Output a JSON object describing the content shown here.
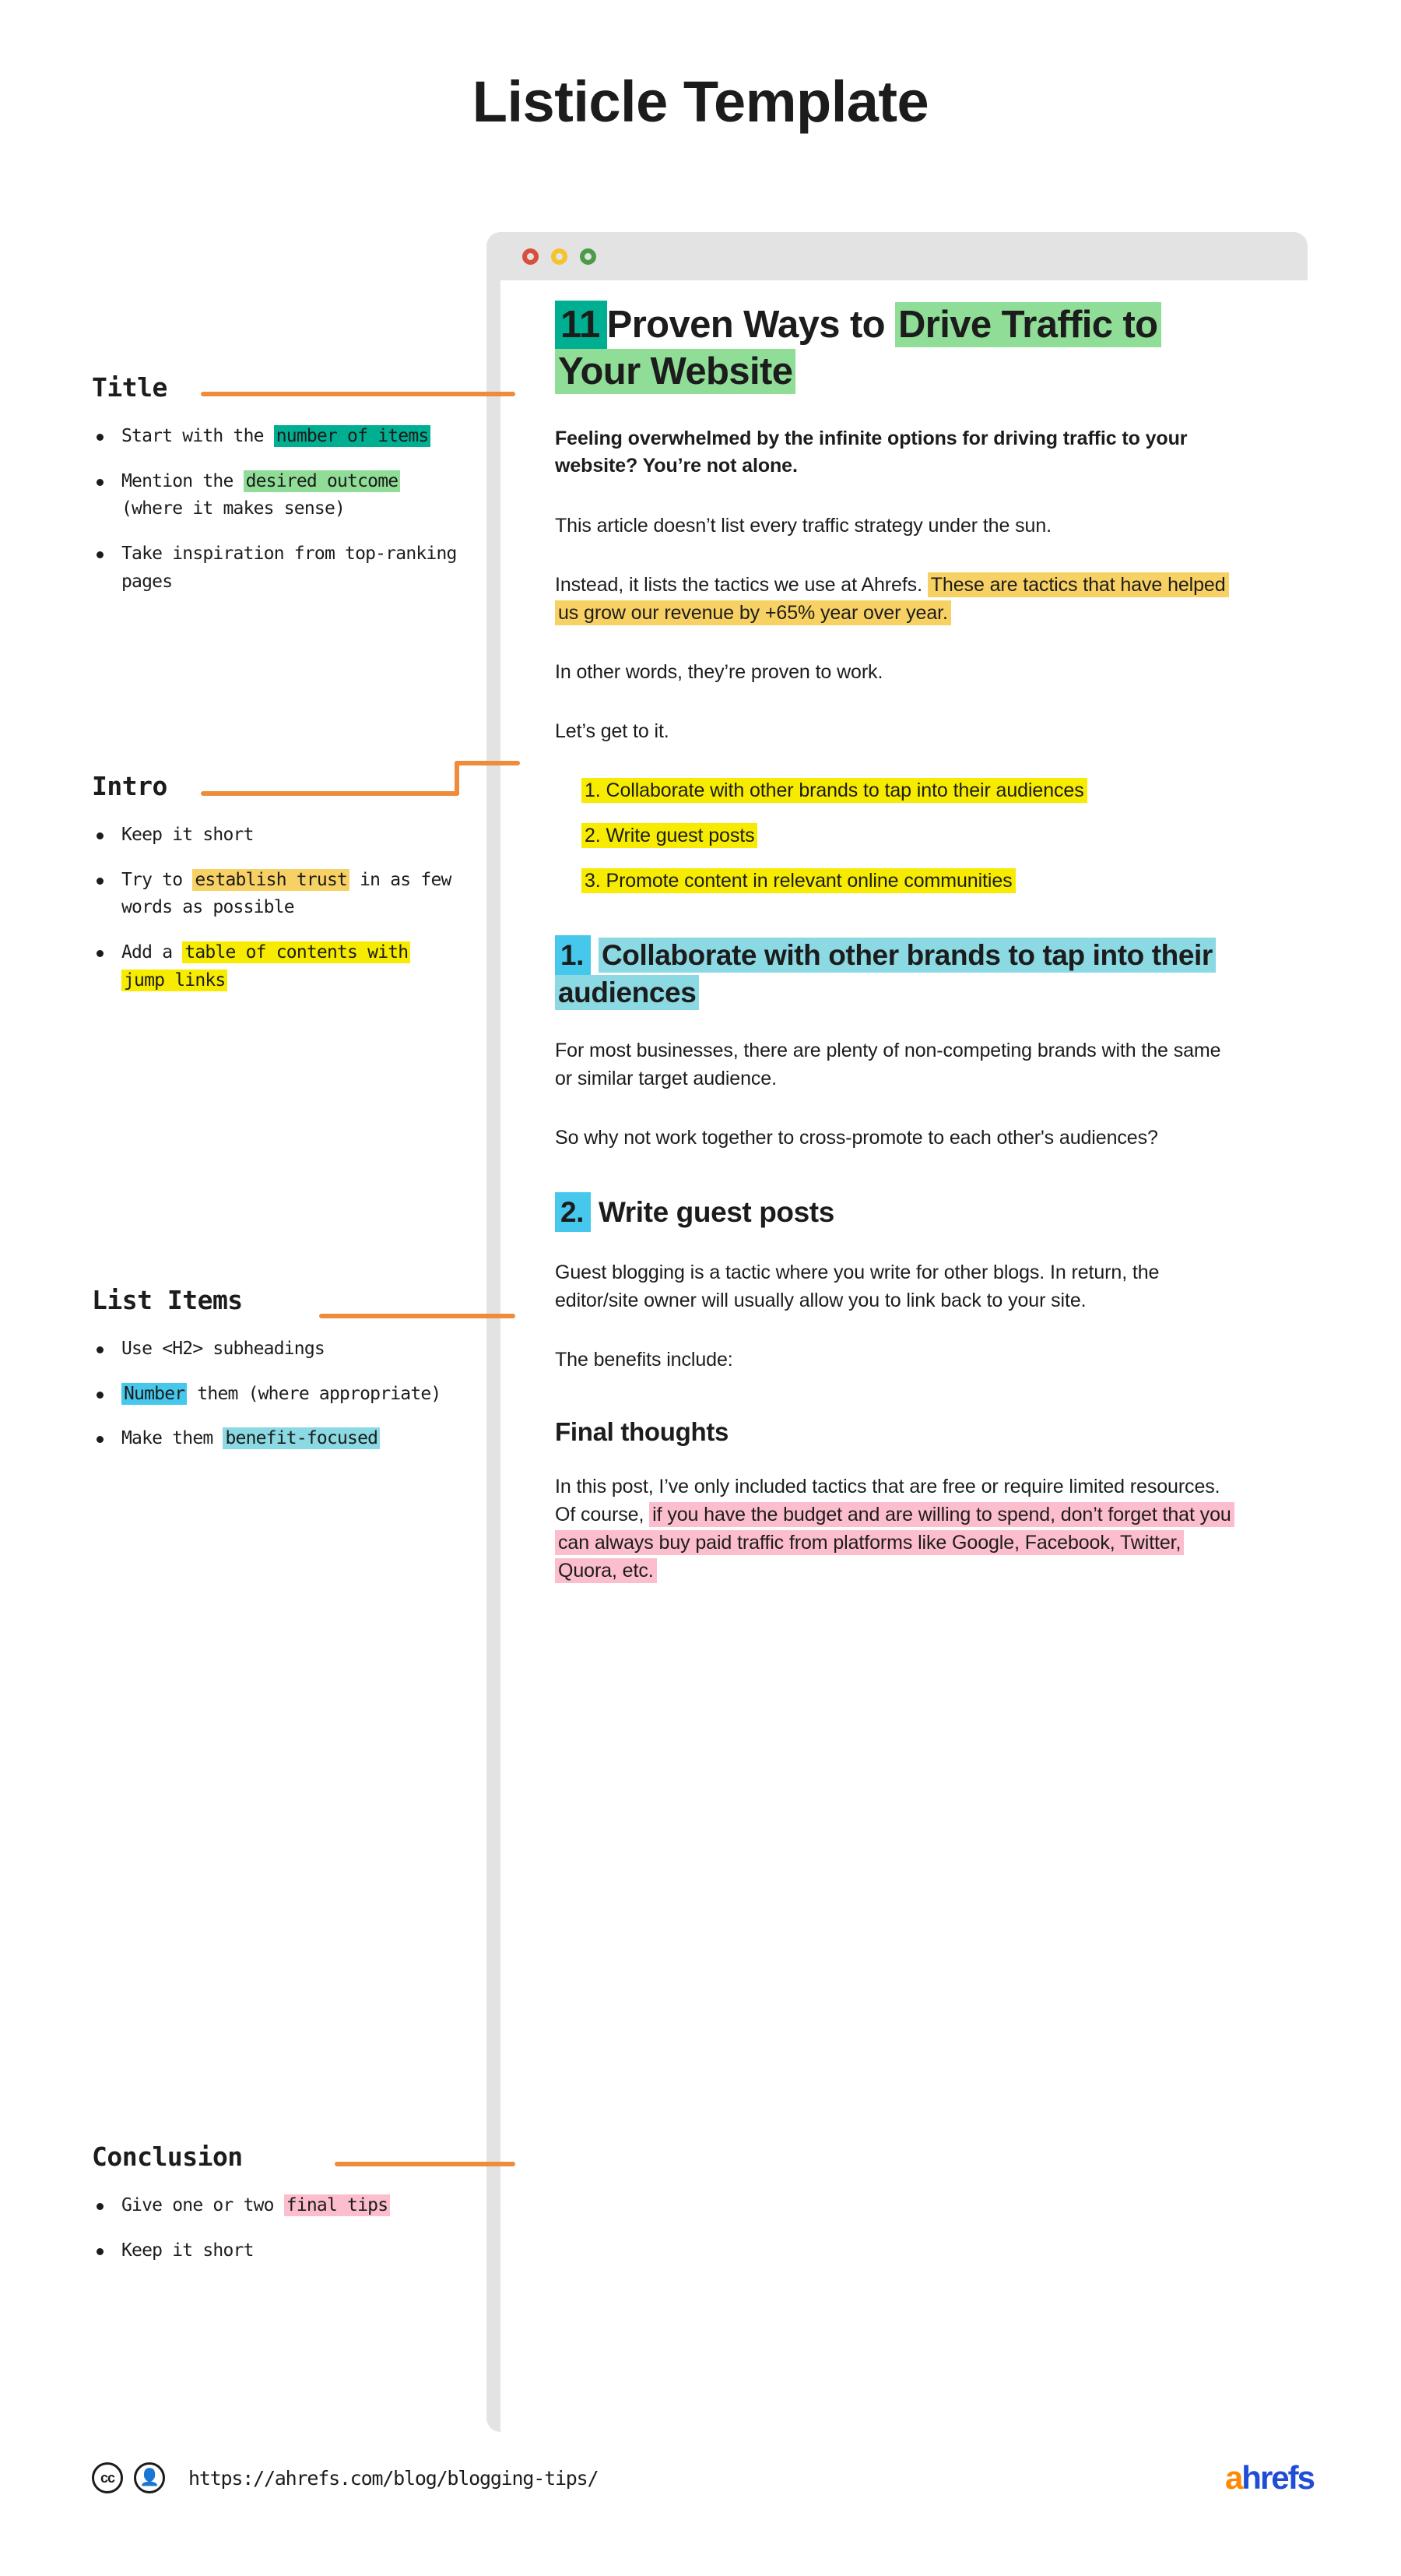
{
  "page_title": "Listicle Template",
  "colors": {
    "accent_orange": "#ee8c3c",
    "highlight_teal": "#00af91",
    "highlight_light_green": "#8fdd97",
    "highlight_amber": "#f7d163",
    "highlight_yellow": "#f7ec00",
    "highlight_cyan": "#45c8ec",
    "highlight_light_cyan": "#8ad9e3",
    "highlight_pink": "#fcbdcd",
    "brand_orange": "#ff8800",
    "brand_blue": "#1f4dd6"
  },
  "browser": {
    "dots": [
      "close-dot-red",
      "minimize-dot-yellow",
      "maximize-dot-green"
    ]
  },
  "annotations": [
    {
      "heading": "Title",
      "items": [
        {
          "pre": "Start with the ",
          "hl": "number of items",
          "post": "",
          "hl_style": "teal"
        },
        {
          "pre": "Mention the ",
          "hl": "desired outcome",
          "post": " (where it makes sense)",
          "hl_style": "lightgrn"
        },
        {
          "pre": "Take inspiration from top-ranking pages",
          "hl": "",
          "post": "",
          "hl_style": ""
        }
      ]
    },
    {
      "heading": "Intro",
      "items": [
        {
          "pre": "Keep it short",
          "hl": "",
          "post": "",
          "hl_style": ""
        },
        {
          "pre": "Try to ",
          "hl": "establish trust",
          "post": " in as few words as possible",
          "hl_style": "amber"
        },
        {
          "pre": "Add a ",
          "hl": "table of contents with jump links",
          "post": "",
          "hl_style": "yellow"
        }
      ]
    },
    {
      "heading": "List Items",
      "items": [
        {
          "pre": "Use <H2> subheadings",
          "hl": "",
          "post": "",
          "hl_style": ""
        },
        {
          "pre": "",
          "hl": "Number",
          "post": " them (where appropriate)",
          "hl_style": "cyan"
        },
        {
          "pre": "Make them ",
          "hl": "benefit-focused",
          "post": "",
          "hl_style": "lightcyan"
        }
      ]
    },
    {
      "heading": "Conclusion",
      "items": [
        {
          "pre": "Give one or two ",
          "hl": "final tips",
          "post": "",
          "hl_style": "pink"
        },
        {
          "pre": "Keep it short",
          "hl": "",
          "post": "",
          "hl_style": ""
        }
      ]
    }
  ],
  "article": {
    "h1": {
      "number": "11",
      "mid": "Proven Ways to ",
      "highlight": "Drive Traffic to Your Website"
    },
    "lead": "Feeling overwhelmed by the infinite options for driving traffic to your website? You’re not alone.",
    "p1": "This article doesn’t list every traffic strategy under the sun.",
    "p2_pre": "Instead, it lists the tactics we use at Ahrefs. ",
    "p2_hl": "These are tactics that have helped us grow our revenue by +65% year over year.",
    "p3": "In other words, they’re proven to work.",
    "p4": "Let’s get to it.",
    "toc": [
      "1. Collaborate with other brands to tap into their audiences",
      "2. Write guest posts",
      "3. Promote content in relevant online communities"
    ],
    "sections": [
      {
        "number": "1.",
        "title": "Collaborate with other brands to tap into their audiences",
        "paragraphs": [
          "For most businesses, there are plenty of non-competing brands with the same or similar target audience.",
          "So why not work together to cross-promote to each other's audiences?"
        ]
      },
      {
        "number": "2.",
        "title": "Write guest posts",
        "paragraphs": [
          "Guest blogging is a tactic where you write for other blogs. In return, the editor/site owner will usually allow you to link back to your site.",
          "The benefits include:"
        ]
      }
    ],
    "final": {
      "heading": "Final thoughts",
      "pre": "In this post, I’ve only included tactics that are free or require limited resources. Of course, ",
      "hl": "if you have the budget and are willing to spend, don’t forget that you can always buy paid traffic from platforms like Google, Facebook, Twitter, Quora, etc."
    }
  },
  "footer": {
    "cc_label": "cc",
    "by_label": "i",
    "url": "https://ahrefs.com/blog/blogging-tips/",
    "brand_a": "a",
    "brand_rest": "hrefs"
  }
}
